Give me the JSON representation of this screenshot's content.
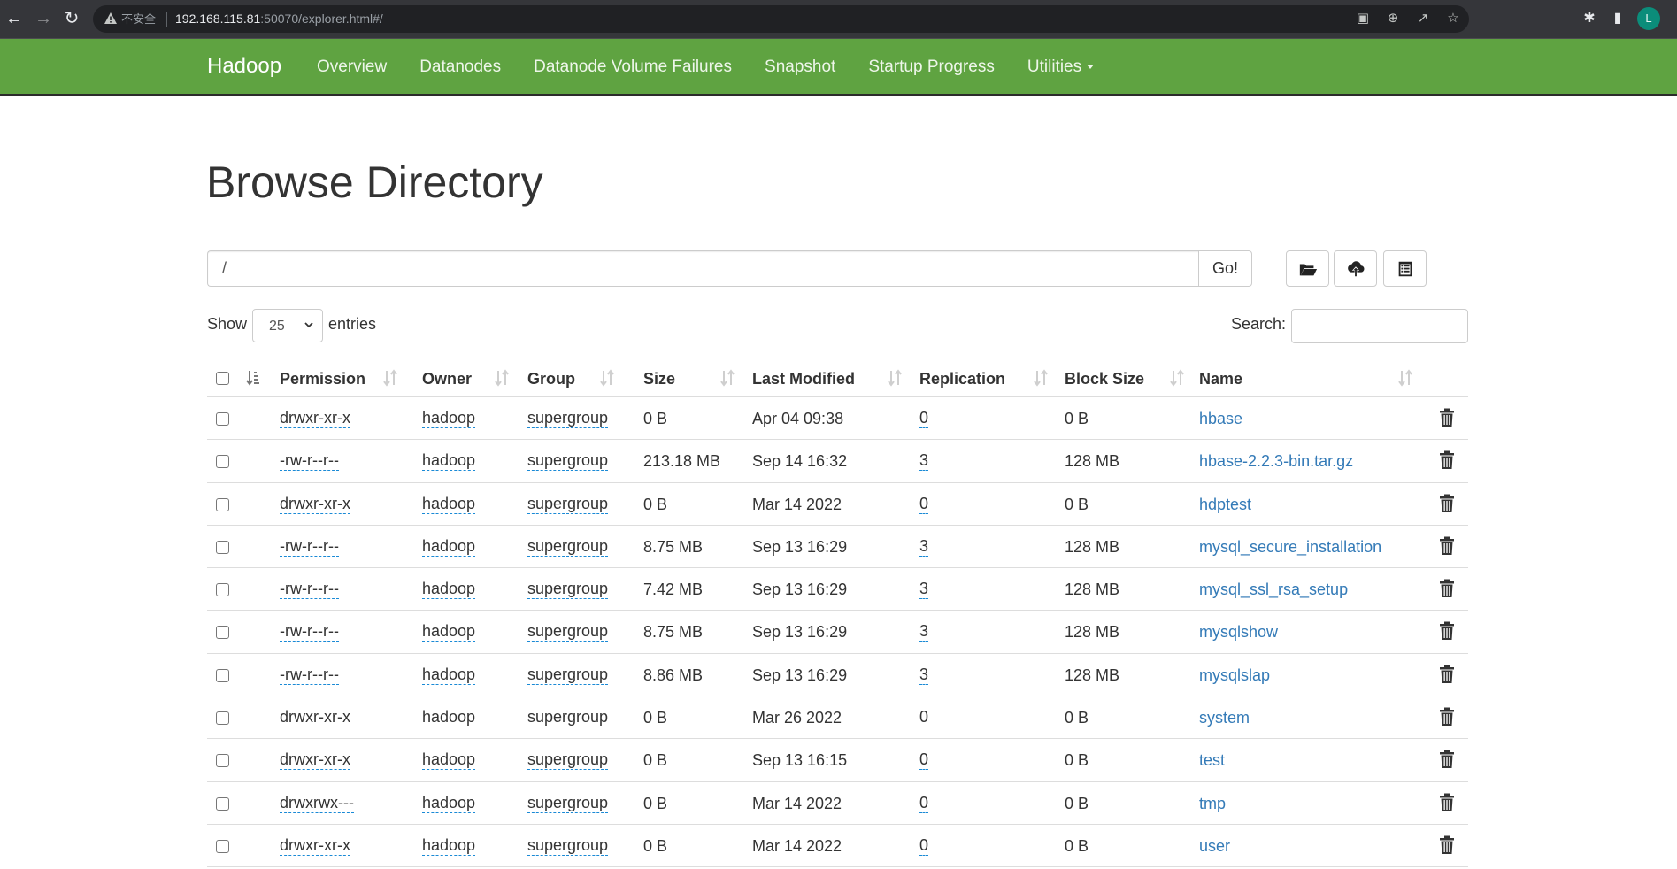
{
  "browser": {
    "url_host": "192.168.115.81",
    "url_rest": ":50070/explorer.html#/",
    "security_label": "不安全",
    "avatar_letter": "L"
  },
  "navbar": {
    "brand": "Hadoop",
    "links": [
      "Overview",
      "Datanodes",
      "Datanode Volume Failures",
      "Snapshot",
      "Startup Progress",
      "Utilities"
    ]
  },
  "page": {
    "title": "Browse Directory",
    "path_value": "/",
    "go_label": "Go!",
    "show_label": "Show",
    "entries_label": "entries",
    "page_size": "25",
    "search_label": "Search:",
    "search_value": ""
  },
  "table": {
    "columns": [
      "Permission",
      "Owner",
      "Group",
      "Size",
      "Last Modified",
      "Replication",
      "Block Size",
      "Name"
    ],
    "rows": [
      {
        "permission": "drwxr-xr-x",
        "owner": "hadoop",
        "group": "supergroup",
        "size": "0 B",
        "modified": "Apr 04 09:38",
        "replication": "0",
        "block_size": "0 B",
        "name": "hbase"
      },
      {
        "permission": "-rw-r--r--",
        "owner": "hadoop",
        "group": "supergroup",
        "size": "213.18 MB",
        "modified": "Sep 14 16:32",
        "replication": "3",
        "block_size": "128 MB",
        "name": "hbase-2.2.3-bin.tar.gz"
      },
      {
        "permission": "drwxr-xr-x",
        "owner": "hadoop",
        "group": "supergroup",
        "size": "0 B",
        "modified": "Mar 14 2022",
        "replication": "0",
        "block_size": "0 B",
        "name": "hdptest"
      },
      {
        "permission": "-rw-r--r--",
        "owner": "hadoop",
        "group": "supergroup",
        "size": "8.75 MB",
        "modified": "Sep 13 16:29",
        "replication": "3",
        "block_size": "128 MB",
        "name": "mysql_secure_installation"
      },
      {
        "permission": "-rw-r--r--",
        "owner": "hadoop",
        "group": "supergroup",
        "size": "7.42 MB",
        "modified": "Sep 13 16:29",
        "replication": "3",
        "block_size": "128 MB",
        "name": "mysql_ssl_rsa_setup"
      },
      {
        "permission": "-rw-r--r--",
        "owner": "hadoop",
        "group": "supergroup",
        "size": "8.75 MB",
        "modified": "Sep 13 16:29",
        "replication": "3",
        "block_size": "128 MB",
        "name": "mysqlshow"
      },
      {
        "permission": "-rw-r--r--",
        "owner": "hadoop",
        "group": "supergroup",
        "size": "8.86 MB",
        "modified": "Sep 13 16:29",
        "replication": "3",
        "block_size": "128 MB",
        "name": "mysqlslap"
      },
      {
        "permission": "drwxr-xr-x",
        "owner": "hadoop",
        "group": "supergroup",
        "size": "0 B",
        "modified": "Mar 26 2022",
        "replication": "0",
        "block_size": "0 B",
        "name": "system"
      },
      {
        "permission": "drwxr-xr-x",
        "owner": "hadoop",
        "group": "supergroup",
        "size": "0 B",
        "modified": "Sep 13 16:15",
        "replication": "0",
        "block_size": "0 B",
        "name": "test"
      },
      {
        "permission": "drwxrwx---",
        "owner": "hadoop",
        "group": "supergroup",
        "size": "0 B",
        "modified": "Mar 14 2022",
        "replication": "0",
        "block_size": "0 B",
        "name": "tmp"
      },
      {
        "permission": "drwxr-xr-x",
        "owner": "hadoop",
        "group": "supergroup",
        "size": "0 B",
        "modified": "Mar 14 2022",
        "replication": "0",
        "block_size": "0 B",
        "name": "user"
      }
    ]
  },
  "colors": {
    "navbar_green": "#5fa341",
    "link_blue": "#337ab7",
    "dotted_underline": "#1a8ad6"
  },
  "icons": {
    "toolbar": [
      "create-directory-icon",
      "upload-icon",
      "cut-paste-icon"
    ],
    "row_action": "trash-icon"
  }
}
